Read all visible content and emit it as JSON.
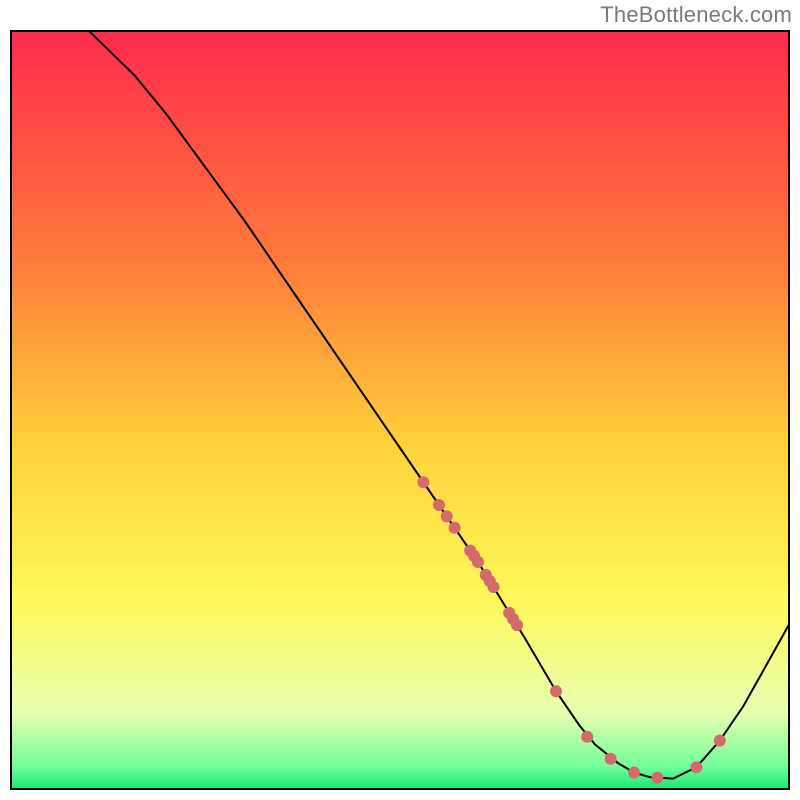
{
  "watermark": "TheBottleneck.com",
  "chart_data": {
    "type": "line",
    "title": "",
    "xlabel": "",
    "ylabel": "",
    "xlim": [
      0,
      100
    ],
    "ylim": [
      0,
      100
    ],
    "background_gradient": {
      "direction": "vertical",
      "stops": [
        {
          "offset": 0.0,
          "color": "#ff2a4d"
        },
        {
          "offset": 0.3,
          "color": "#ff7a3a"
        },
        {
          "offset": 0.55,
          "color": "#ffd23a"
        },
        {
          "offset": 0.75,
          "color": "#fff85a"
        },
        {
          "offset": 0.9,
          "color": "#e7ffb0"
        },
        {
          "offset": 0.97,
          "color": "#73ff9a"
        },
        {
          "offset": 1.0,
          "color": "#16e873"
        }
      ]
    },
    "series": [
      {
        "name": "bottleneck-curve",
        "type": "line",
        "color": "#000000",
        "x": [
          10,
          13,
          16,
          20,
          25,
          30,
          35,
          40,
          45,
          50,
          55,
          60,
          63,
          66,
          70,
          73,
          75,
          78,
          80,
          82,
          85,
          88,
          91,
          94,
          97,
          100
        ],
        "y": [
          100,
          97,
          94,
          89,
          82,
          75,
          67.5,
          60,
          52.5,
          45,
          37.5,
          30,
          25,
          20,
          13,
          8.5,
          6,
          3.5,
          2.3,
          1.7,
          1.5,
          3,
          6.5,
          11,
          16.5,
          22
        ]
      }
    ],
    "points": {
      "name": "highlighted-points",
      "color": "#d66a6a",
      "radius": 6,
      "x": [
        53,
        55,
        56,
        57,
        59,
        59.5,
        60,
        61,
        61.5,
        62,
        64,
        64.5,
        65,
        70,
        74,
        77,
        80,
        83,
        88,
        91
      ],
      "y": [
        40.5,
        37.5,
        36,
        34.5,
        31.5,
        30.8,
        30,
        28.3,
        27.5,
        26.7,
        23.3,
        22.5,
        21.7,
        13,
        7,
        4.1,
        2.3,
        1.6,
        3,
        6.5
      ]
    }
  }
}
